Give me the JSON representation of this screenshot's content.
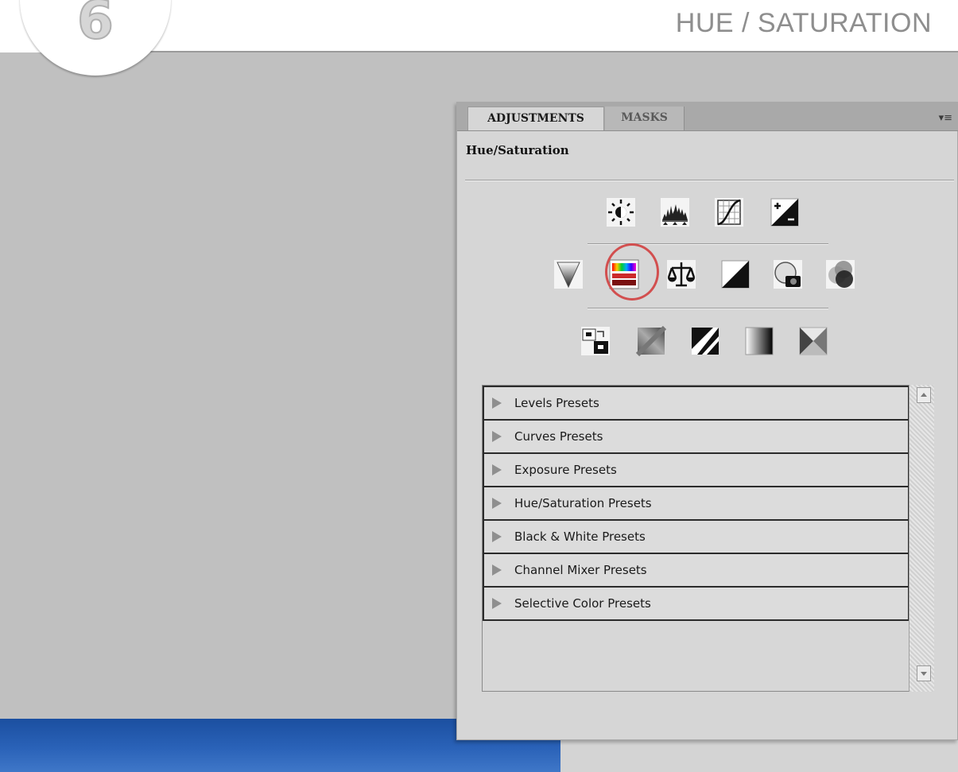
{
  "header": {
    "step_number": "6",
    "title": "HUE / SATURATION"
  },
  "panel": {
    "tabs": [
      {
        "label": "ADJUSTMENTS",
        "active": true
      },
      {
        "label": "MASKS",
        "active": false
      }
    ],
    "menu_icon": "panel-menu-icon",
    "menu_glyph": "▾≡",
    "title": "Hue/Saturation",
    "icon_rows": [
      [
        "brightness-contrast-icon",
        "levels-icon",
        "curves-icon",
        "exposure-icon"
      ],
      [
        "vibrance-icon",
        "hue-saturation-icon",
        "color-balance-icon",
        "black-white-icon",
        "photo-filter-icon",
        "channel-mixer-icon"
      ],
      [
        "invert-icon",
        "posterize-icon",
        "threshold-icon",
        "gradient-map-icon",
        "selective-color-icon"
      ]
    ],
    "highlighted_icon": "hue-saturation-icon",
    "highlight_color": "#d24f4f",
    "presets": [
      "Levels Presets",
      "Curves Presets",
      "Exposure Presets",
      "Hue/Saturation Presets",
      "Black & White Presets",
      "Channel Mixer Presets",
      "Selective Color Presets"
    ]
  }
}
